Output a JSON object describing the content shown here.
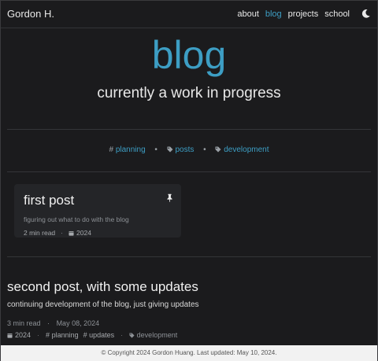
{
  "header": {
    "brand": "Gordon H.",
    "nav": [
      {
        "label": "about"
      },
      {
        "label": "blog"
      },
      {
        "label": "projects"
      },
      {
        "label": "school"
      }
    ],
    "theme_toggle_icon": "moon-icon"
  },
  "hero": {
    "title": "blog",
    "subtitle": "currently a work in progress"
  },
  "tags": [
    {
      "label": "planning",
      "icon": "hash-icon"
    },
    {
      "label": "posts",
      "icon": "tag-icon"
    },
    {
      "label": "development",
      "icon": "tag-icon"
    }
  ],
  "pinned_post": {
    "title": "first post",
    "description": "figuring out what to do with the blog",
    "read_time": "2 min read",
    "year": "2024",
    "pin_icon": "pin-icon"
  },
  "post": {
    "title": "second post, with some updates",
    "description": "continuing development of the blog, just giving updates",
    "read_time": "3 min read",
    "date": "May 08, 2024",
    "year": "2024",
    "tags": [
      "planning",
      "updates",
      "development"
    ]
  },
  "footer": {
    "text": "© Copyright 2024 Gordon Huang. Last updated: May 10, 2024."
  },
  "colors": {
    "accent": "#3d9ec4",
    "background": "#1b1b1d",
    "card": "#242528",
    "footer": "#f2f2f2"
  }
}
